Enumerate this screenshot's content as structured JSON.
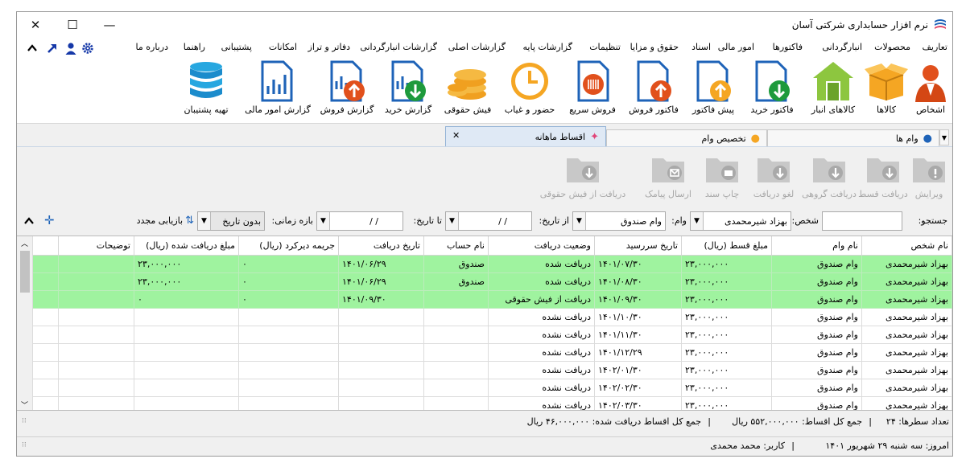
{
  "window": {
    "title": "نرم افزار حسابداری شرکتی آسان",
    "minimize": "—",
    "maximize": "☐",
    "close": "✕"
  },
  "menu": [
    "تعاریف",
    "محصولات",
    "انبارگردانی",
    "فاکتورها",
    "امور مالی",
    "اسناد",
    "حقوق و مزایا",
    "تنظیمات",
    "گزارشات پایه",
    "گزارشات اصلی",
    "گزارشات انبارگردانی",
    "دفاتر و تراز",
    "امکانات",
    "پشتیبانی",
    "راهنما",
    "درباره ما"
  ],
  "ribbon": [
    "اشخاص",
    "کالاها",
    "کالاهای انبار",
    "فاکتور خرید",
    "پیش فاکتور",
    "فاکتور فروش",
    "فروش سریع",
    "حضور و غیاب",
    "فیش حقوقی",
    "گزارش خرید",
    "گزارش فروش",
    "گزارش امور مالی",
    "تهیه پشتیبان"
  ],
  "tabs": {
    "loans": "وام ها",
    "allocation": "تخصیص وام",
    "installments": "اقساط ماهانه",
    "close": "✕"
  },
  "toolbar": [
    "ویرایش",
    "دریافت قسط",
    "دریافت گروهی",
    "لغو دریافت",
    "چاپ سند",
    "ارسال پیامک",
    "دریافت از فیش حقوقی"
  ],
  "filters": {
    "search_label": "جستجو:",
    "search_value": "",
    "person_label": "شخص:",
    "person_value": "بهزاد شیرمحمدی",
    "loan_label": "وام:",
    "loan_value": "وام صندوق",
    "from_label": "از تاریخ:",
    "from_value": "/    /",
    "to_label": "تا تاریخ:",
    "to_value": "/    /",
    "range_label": "بازه زمانی:",
    "range_value": "بدون تاریخ",
    "refresh_label": "بازیابی مجدد"
  },
  "grid": {
    "headers": [
      "نام شخص",
      "نام وام",
      "مبلغ قسط (ریال)",
      "تاریخ سررسید",
      "وضعیت دریافت",
      "نام حساب",
      "تاریخ دریافت",
      "جریمه دیرکرد (ریال)",
      "مبلغ دریافت شده (ریال)",
      "توضیحات"
    ],
    "rows": [
      {
        "c": [
          "بهزاد شیرمحمدی",
          "وام صندوق",
          "۲۳,۰۰۰,۰۰۰",
          "۱۴۰۱/۰۷/۳۰",
          "دریافت شده",
          "صندوق",
          "۱۴۰۱/۰۶/۲۹",
          "۰",
          "۲۳,۰۰۰,۰۰۰",
          ""
        ],
        "status": "green"
      },
      {
        "c": [
          "بهزاد شیرمحمدی",
          "وام صندوق",
          "۲۳,۰۰۰,۰۰۰",
          "۱۴۰۱/۰۸/۳۰",
          "دریافت شده",
          "صندوق",
          "۱۴۰۱/۰۶/۲۹",
          "۰",
          "۲۳,۰۰۰,۰۰۰",
          ""
        ],
        "status": "green"
      },
      {
        "c": [
          "بهزاد شیرمحمدی",
          "وام صندوق",
          "۲۳,۰۰۰,۰۰۰",
          "۱۴۰۱/۰۹/۳۰",
          "دریافت از فیش حقوقی",
          "",
          "۱۴۰۱/۰۹/۳۰",
          "۰",
          "۰",
          ""
        ],
        "status": "green"
      },
      {
        "c": [
          "بهزاد شیرمحمدی",
          "وام صندوق",
          "۲۳,۰۰۰,۰۰۰",
          "۱۴۰۱/۱۰/۳۰",
          "دریافت نشده",
          "",
          "",
          "",
          "",
          ""
        ],
        "status": ""
      },
      {
        "c": [
          "بهزاد شیرمحمدی",
          "وام صندوق",
          "۲۳,۰۰۰,۰۰۰",
          "۱۴۰۱/۱۱/۳۰",
          "دریافت نشده",
          "",
          "",
          "",
          "",
          ""
        ],
        "status": ""
      },
      {
        "c": [
          "بهزاد شیرمحمدی",
          "وام صندوق",
          "۲۳,۰۰۰,۰۰۰",
          "۱۴۰۱/۱۲/۲۹",
          "دریافت نشده",
          "",
          "",
          "",
          "",
          ""
        ],
        "status": ""
      },
      {
        "c": [
          "بهزاد شیرمحمدی",
          "وام صندوق",
          "۲۳,۰۰۰,۰۰۰",
          "۱۴۰۲/۰۱/۳۰",
          "دریافت نشده",
          "",
          "",
          "",
          "",
          ""
        ],
        "status": ""
      },
      {
        "c": [
          "بهزاد شیرمحمدی",
          "وام صندوق",
          "۲۳,۰۰۰,۰۰۰",
          "۱۴۰۲/۰۲/۳۰",
          "دریافت نشده",
          "",
          "",
          "",
          "",
          ""
        ],
        "status": ""
      },
      {
        "c": [
          "بهزاد شیرمحمدی",
          "وام صندوق",
          "۲۳,۰۰۰,۰۰۰",
          "۱۴۰۲/۰۳/۳۰",
          "دریافت نشده",
          "",
          "",
          "",
          "",
          ""
        ],
        "status": ""
      }
    ]
  },
  "summary": {
    "rows_label": "تعداد سطرها:",
    "rows_value": "۲۴",
    "total_label": "جمع کل اقساط:",
    "total_value": "۵۵۲,۰۰۰,۰۰۰ ریال",
    "received_label": "جمع کل اقساط دریافت شده:",
    "received_value": "۴۶,۰۰۰,۰۰۰ ریال"
  },
  "footer": {
    "today_label": "امروز:",
    "today_value": "سه شنبه ۲۹ شهریور ۱۴۰۱",
    "user_label": "کاربر:",
    "user_value": "محمد محمدی"
  },
  "colors": {
    "paid_row": "#9ff39f",
    "accent": "#1a5fb4"
  }
}
